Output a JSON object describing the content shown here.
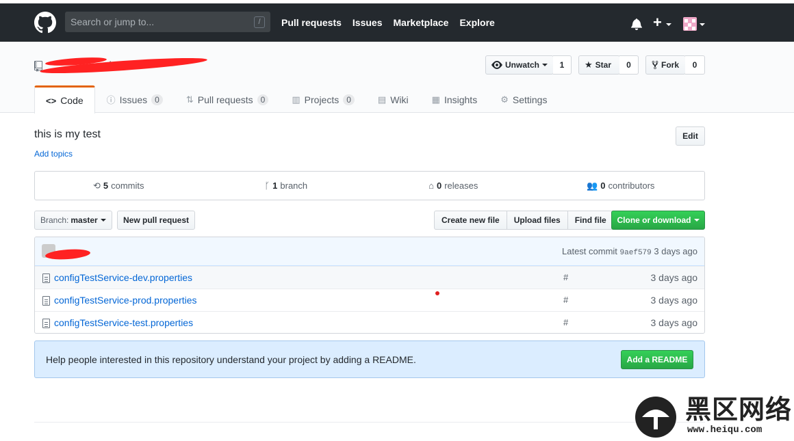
{
  "header": {
    "search_placeholder": "Search or jump to...",
    "search_shortcut": "/",
    "nav": [
      "Pull requests",
      "Issues",
      "Marketplace",
      "Explore"
    ],
    "plus": "+"
  },
  "repo": {
    "title_separator": "/",
    "watch": {
      "label": "Unwatch",
      "count": "1"
    },
    "star": {
      "label": "Star",
      "count": "0"
    },
    "fork": {
      "label": "Fork",
      "count": "0"
    }
  },
  "tabs": [
    {
      "label": "Code",
      "icon": "<>",
      "counter": ""
    },
    {
      "label": "Issues",
      "icon": "!",
      "counter": "0"
    },
    {
      "label": "Pull requests",
      "icon": "pr",
      "counter": "0"
    },
    {
      "label": "Projects",
      "icon": "board",
      "counter": "0"
    },
    {
      "label": "Wiki",
      "icon": "book",
      "counter": ""
    },
    {
      "label": "Insights",
      "icon": "graph",
      "counter": ""
    },
    {
      "label": "Settings",
      "icon": "gear",
      "counter": ""
    }
  ],
  "about": {
    "description": "this is my test",
    "add_topics": "Add topics",
    "edit": "Edit"
  },
  "summary": {
    "commits": {
      "count": "5",
      "label": "commits"
    },
    "branches": {
      "count": "1",
      "label": "branch"
    },
    "releases": {
      "count": "0",
      "label": "releases"
    },
    "contributors": {
      "count": "0",
      "label": "contributors"
    }
  },
  "toolbar": {
    "branch_prefix": "Branch:",
    "branch_name": "master",
    "new_pr": "New pull request",
    "create_file": "Create new file",
    "upload": "Upload files",
    "find": "Find file",
    "clone": "Clone or download"
  },
  "commit": {
    "latest_label": "Latest commit",
    "sha": "9aef579",
    "age": "3 days ago"
  },
  "files": [
    {
      "name": "configTestService-dev.properties",
      "message": "#",
      "age": "3 days ago"
    },
    {
      "name": "configTestService-prod.properties",
      "message": "#",
      "age": "3 days ago"
    },
    {
      "name": "configTestService-test.properties",
      "message": "#",
      "age": "3 days ago"
    }
  ],
  "readme": {
    "text": "Help people interested in this repository understand your project by adding a README.",
    "button": "Add a README"
  },
  "watermark": {
    "title": "黑区网络",
    "url": "www.heiqu.com"
  },
  "colors": {
    "header_bg": "#24292e",
    "link": "#0366d6",
    "green": "#28a745",
    "tab_accent": "#e36209",
    "redaction": "#ff2222"
  }
}
